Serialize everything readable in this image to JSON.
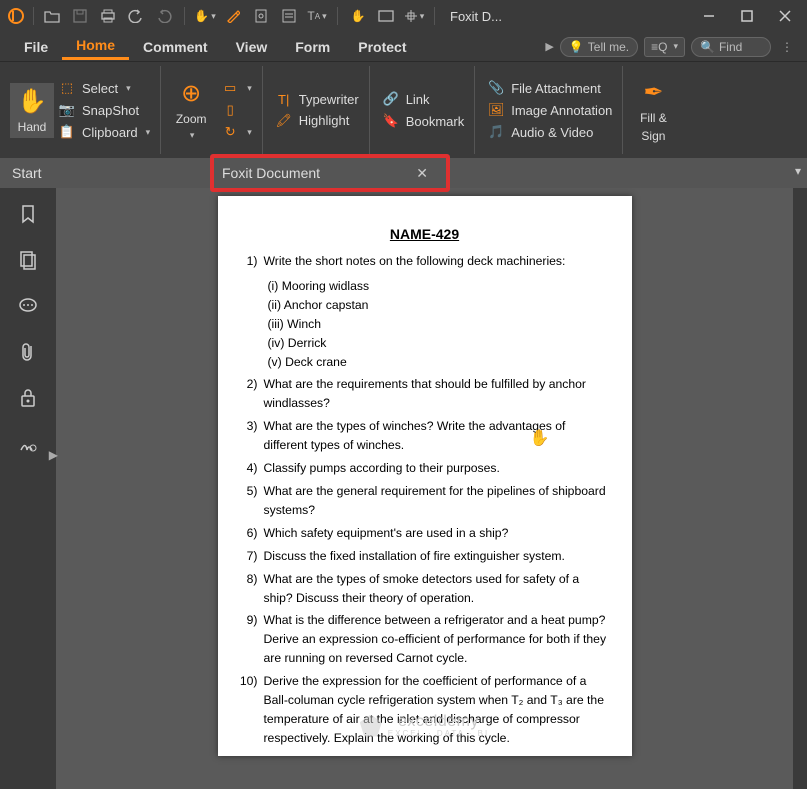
{
  "titlebar": {
    "app_title": "Foxit D..."
  },
  "menu": {
    "file": "File",
    "home": "Home",
    "comment": "Comment",
    "view": "View",
    "form": "Form",
    "protect": "Protect",
    "tellme_placeholder": "Tell me.",
    "find_placeholder": "Find",
    "ai_label": "≡Q"
  },
  "ribbon": {
    "hand": "Hand",
    "select": "Select",
    "snapshot": "SnapShot",
    "clipboard": "Clipboard",
    "zoom": "Zoom",
    "typewriter": "Typewriter",
    "highlight": "Highlight",
    "link": "Link",
    "bookmark": "Bookmark",
    "file_attachment": "File Attachment",
    "image_annotation": "Image Annotation",
    "audio_video": "Audio & Video",
    "fill_sign": "Fill &",
    "fill_sign2": "Sign"
  },
  "tabs": {
    "start": "Start",
    "doc": "Foxit Document"
  },
  "page": {
    "title": "NAME-429",
    "questions": [
      {
        "n": "1)",
        "t": "Write the short notes on the following deck machineries:",
        "sub": [
          "(i) Mooring widlass",
          "(ii) Anchor capstan",
          "(iii) Winch",
          "(iv) Derrick",
          "(v) Deck crane"
        ]
      },
      {
        "n": "2)",
        "t": " What are the requirements that should be fulfilled by anchor windlasses?"
      },
      {
        "n": "3)",
        "t": "What are the types of winches? Write the advantages of different types of winches."
      },
      {
        "n": "4)",
        "t": "Classify pumps according to their purposes."
      },
      {
        "n": "5)",
        "t": "What are the general requirement for the pipelines of shipboard systems?"
      },
      {
        "n": "6)",
        "t": "Which safety equipment's are used in a ship?"
      },
      {
        "n": "7)",
        "t": "Discuss the fixed installation of fire extinguisher system."
      },
      {
        "n": "8)",
        "t": "What are the types of smoke detectors used for safety of a ship? Discuss their theory of operation."
      },
      {
        "n": "9)",
        "t": "What is the difference between a refrigerator and a heat pump? Derive an expression co-efficient of performance for both if they are running on reversed Carnot cycle."
      },
      {
        "n": "10)",
        "t": "Derive the expression for the coefficient of performance of a Ball-columan cycle refrigeration system when T₂ and T₃ are the temperature of air at the inlet and discharge of compressor respectively. Explain the working of this cycle."
      }
    ],
    "watermark": "exceldemy",
    "watermark_sub": "EXCEL · DATA · BI"
  }
}
